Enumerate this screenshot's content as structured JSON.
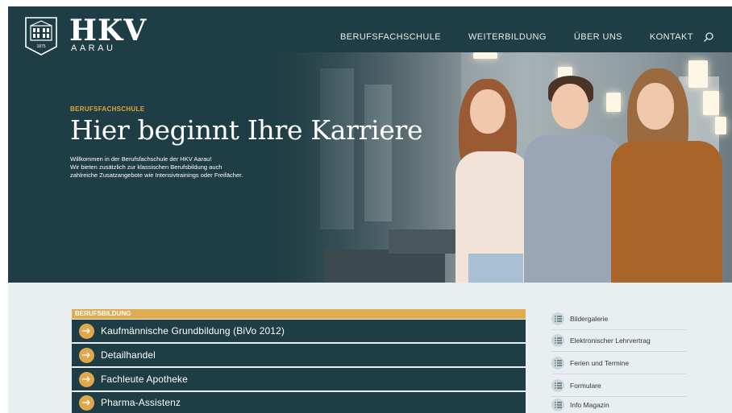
{
  "logo": {
    "name": "HKV",
    "sub": "AARAU",
    "emblem_year": "1875"
  },
  "nav": {
    "items": [
      "BERUFSFACHSCHULE",
      "WEITERBILDUNG",
      "ÜBER UNS",
      "KONTAKT"
    ],
    "search_icon": "search-icon"
  },
  "hero": {
    "kicker": "BERUFSFACHSCHULE",
    "title": "Hier beginnt Ihre Karriere",
    "text_lines": [
      "Willkommen in der Berufsfachschule der HKV Aarau!",
      "Wir bieten zusätzlich zur klassischen Berufsbildung auch",
      "zahlreiche Zusatzangebote wie Intensivtrainings oder Freifächer."
    ]
  },
  "berufsbildung": {
    "header": "BERUFSBILDUNG",
    "items": [
      "Kaufmännische Grundbildung (BiVo 2012)",
      "Detailhandel",
      "Fachleute Apotheke",
      "Pharma-Assistenz"
    ],
    "arrow_icon": "arrow-right-icon"
  },
  "sidebar": {
    "items": [
      "Bildergalerie",
      "Elektronischer Lehrvertrag",
      "Ferien und Termine",
      "Formulare",
      "Info Magazin"
    ],
    "icon": "list-icon"
  },
  "colors": {
    "primary": "#1f3d44",
    "accent": "#e0a84d",
    "background": "#e9eef0"
  }
}
